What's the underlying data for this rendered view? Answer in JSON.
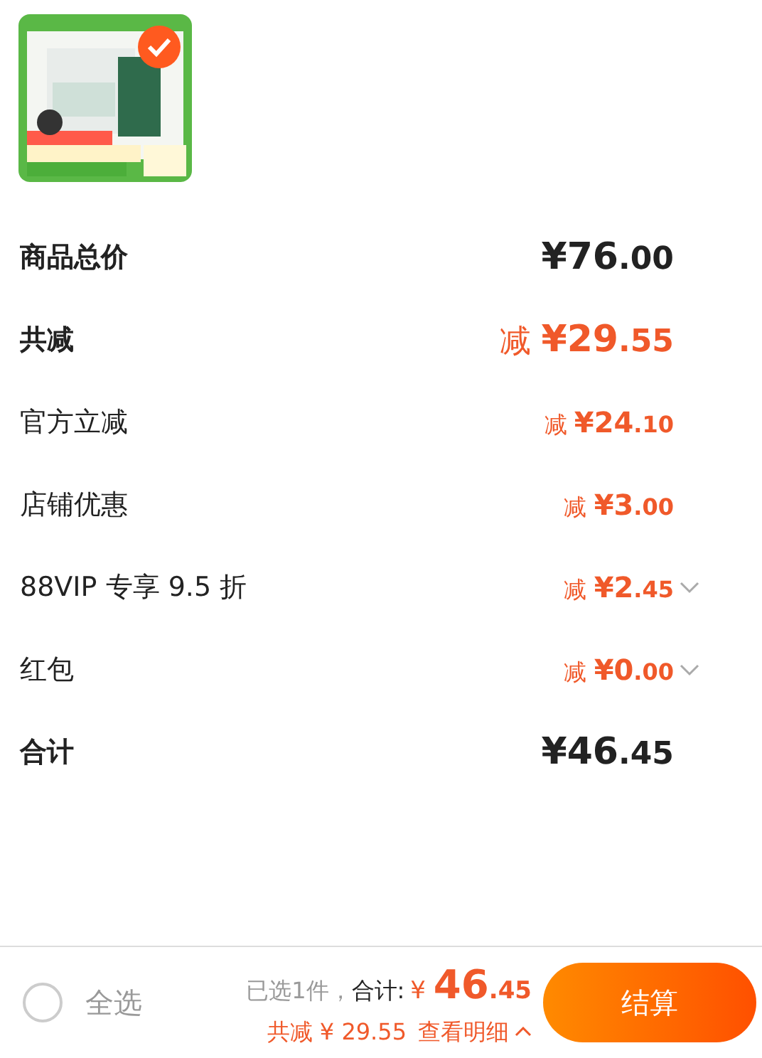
{
  "product": {
    "kind": "picture",
    "selected": true
  },
  "rows": [
    {
      "kind": "sum",
      "label": "商品总价",
      "currency": "¥",
      "integer": "76",
      "decimals": ".00",
      "expandable": false
    },
    {
      "kind": "discount_total",
      "label": "共减",
      "prefix": "减",
      "currency": "¥",
      "integer": "29",
      "decimals": ".55",
      "expandable": false
    },
    {
      "kind": "discount",
      "label": "官方立减",
      "prefix": "减",
      "currency": "¥",
      "integer": "24",
      "decimals": ".10",
      "expandable": false
    },
    {
      "kind": "discount",
      "label": "店铺优惠",
      "prefix": "减",
      "currency": "¥",
      "integer": "3",
      "decimals": ".00",
      "expandable": false
    },
    {
      "kind": "discount",
      "label": "88VIP 专享 9.5 折",
      "prefix": "减",
      "currency": "¥",
      "integer": "2",
      "decimals": ".45",
      "expandable": true
    },
    {
      "kind": "discount",
      "label": "红包",
      "prefix": "减",
      "currency": "¥",
      "integer": "0",
      "decimals": ".00",
      "expandable": true
    },
    {
      "kind": "sum",
      "label": "合计",
      "currency": "¥",
      "integer": "46",
      "decimals": ".45",
      "expandable": false
    }
  ],
  "bottom_bar": {
    "select_all": {
      "label": "全选",
      "checked": false
    },
    "selected_count": "已选1件，",
    "total_label": "合计:",
    "total": {
      "currency": "¥",
      "integer": "46",
      "decimals": ".45"
    },
    "discount_summary": "共减 ¥ 29.55",
    "details_link": {
      "label": "查看明细",
      "expanded": false
    },
    "checkout_button": "结算"
  }
}
